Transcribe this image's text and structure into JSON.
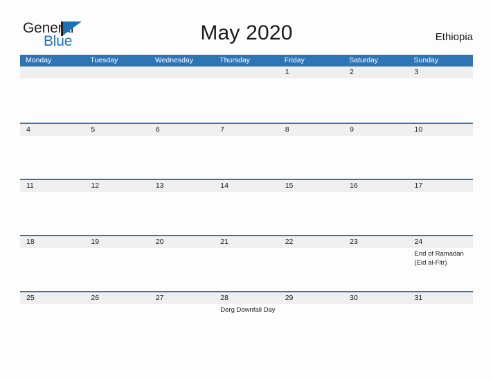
{
  "brand": {
    "word1": "General",
    "word2": "Blue",
    "flag_color": "#1c72b8",
    "icon": "general-blue-flag-logo"
  },
  "header": {
    "title": "May 2020",
    "country": "Ethiopia",
    "accent_color": "#2e75b6",
    "band_color": "#efefef"
  },
  "calendar": {
    "weekdays": [
      "Monday",
      "Tuesday",
      "Wednesday",
      "Thursday",
      "Friday",
      "Saturday",
      "Sunday"
    ],
    "weeks": [
      {
        "days": [
          {
            "num": "",
            "event": ""
          },
          {
            "num": "",
            "event": ""
          },
          {
            "num": "",
            "event": ""
          },
          {
            "num": "",
            "event": ""
          },
          {
            "num": "1",
            "event": ""
          },
          {
            "num": "2",
            "event": ""
          },
          {
            "num": "3",
            "event": ""
          }
        ]
      },
      {
        "days": [
          {
            "num": "4",
            "event": ""
          },
          {
            "num": "5",
            "event": ""
          },
          {
            "num": "6",
            "event": ""
          },
          {
            "num": "7",
            "event": ""
          },
          {
            "num": "8",
            "event": ""
          },
          {
            "num": "9",
            "event": ""
          },
          {
            "num": "10",
            "event": ""
          }
        ]
      },
      {
        "days": [
          {
            "num": "11",
            "event": ""
          },
          {
            "num": "12",
            "event": ""
          },
          {
            "num": "13",
            "event": ""
          },
          {
            "num": "14",
            "event": ""
          },
          {
            "num": "15",
            "event": ""
          },
          {
            "num": "16",
            "event": ""
          },
          {
            "num": "17",
            "event": ""
          }
        ]
      },
      {
        "days": [
          {
            "num": "18",
            "event": ""
          },
          {
            "num": "19",
            "event": ""
          },
          {
            "num": "20",
            "event": ""
          },
          {
            "num": "21",
            "event": ""
          },
          {
            "num": "22",
            "event": ""
          },
          {
            "num": "23",
            "event": ""
          },
          {
            "num": "24",
            "event": "End of Ramadan\n(Eid al-Fitr)"
          }
        ]
      },
      {
        "days": [
          {
            "num": "25",
            "event": ""
          },
          {
            "num": "26",
            "event": ""
          },
          {
            "num": "27",
            "event": ""
          },
          {
            "num": "28",
            "event": "Derg Downfall Day"
          },
          {
            "num": "29",
            "event": ""
          },
          {
            "num": "30",
            "event": ""
          },
          {
            "num": "31",
            "event": ""
          }
        ]
      }
    ]
  }
}
